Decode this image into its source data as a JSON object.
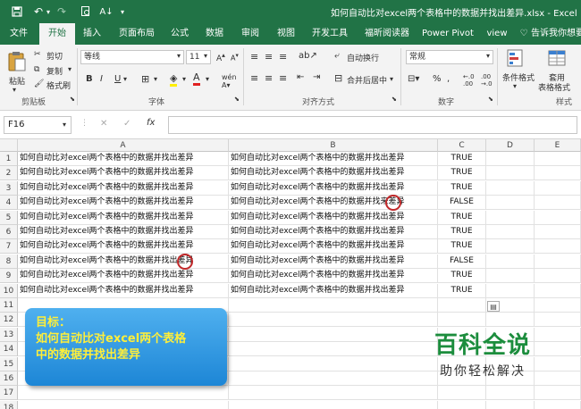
{
  "window": {
    "title": "如何自动比对excel两个表格中的数据并找出差异.xlsx  -  Excel"
  },
  "tabs": [
    "文件",
    "开始",
    "插入",
    "页面布局",
    "公式",
    "数据",
    "审阅",
    "视图",
    "开发工具",
    "福昕阅读器",
    "Power Pivot",
    "view",
    "告诉我你想要"
  ],
  "ribbon": {
    "paste": "粘贴",
    "cut": "剪切",
    "copy": "复制",
    "format_painter": "格式刷",
    "clipboard": "剪贴板",
    "font_name": "等线",
    "font_size": "11",
    "font_group": "字体",
    "wrap_text": "自动换行",
    "merge_center": "合并后居中",
    "alignment_group": "对齐方式",
    "number_format": "常规",
    "number_group": "数字",
    "percent": "%",
    "comma": ",",
    "conditional_format": "条件格式",
    "table_format_1": "套用",
    "table_format_2": "表格格式",
    "styles_group": "样式",
    "bold": "B",
    "italic": "I",
    "underline": "U"
  },
  "formula_bar": {
    "name_box": "F16",
    "fx": "fx",
    "cancel": "✕",
    "enter": "✓"
  },
  "grid": {
    "columns": [
      "A",
      "B",
      "C",
      "D",
      "E"
    ],
    "rows": [
      "1",
      "2",
      "3",
      "4",
      "5",
      "6",
      "7",
      "8",
      "9",
      "10",
      "11",
      "12",
      "13",
      "14",
      "15",
      "16",
      "17",
      "18"
    ],
    "col_a": [
      "如何自动比对excel两个表格中的数据并找出差异",
      "如何自动比对excel两个表格中的数据并找出差异",
      "如何自动比对excel两个表格中的数据并找出差异",
      "如何自动比对excel两个表格中的数据并找出差异",
      "如何自动比对excel两个表格中的数据并找出差异",
      "如何自动比对excel两个表格中的数据并找出差异",
      "如何自动比对excel两个表格中的数据并找出差异",
      "如何自动比对excel两个表格中的数据并找出差异",
      "如何自动比对excel两个表格中的数据并找出差异",
      "如何自动比对excel两个表格中的数据并找出差异"
    ],
    "col_b": [
      "如何自动比对excel两个表格中的数据并找出差异",
      "如何自动比对excel两个表格中的数据并找出差异",
      "如何自动比对excel两个表格中的数据并找出差异",
      "如何自动比对excel两个表格中的数据并找来差异",
      "如何自动比对excel两个表格中的数据并找出差异",
      "如何自动比对excel两个表格中的数据并找出差异",
      "如何自动比对excel两个表格中的数据并找出差异",
      "如何自动比对excel两个表格中的数据并找出差异",
      "如何自动比对excel两个表格中的数据并找出差异",
      "如何自动比对excel两个表格中的数据并找出差异"
    ],
    "col_c": [
      "TRUE",
      "TRUE",
      "TRUE",
      "FALSE",
      "TRUE",
      "TRUE",
      "TRUE",
      "FALSE",
      "TRUE",
      "TRUE"
    ]
  },
  "goal": {
    "heading": "目标：",
    "line1": "如何自动比对excel两个表格",
    "line2": "中的数据并找出差异"
  },
  "watermark": {
    "line1": "百科全说",
    "line2": "助你轻松解决"
  },
  "colors": {
    "excel_green": "#217346",
    "mark_red": "#c0282a",
    "goal_blue": "#1d86d6",
    "goal_text": "#ffef3a"
  }
}
